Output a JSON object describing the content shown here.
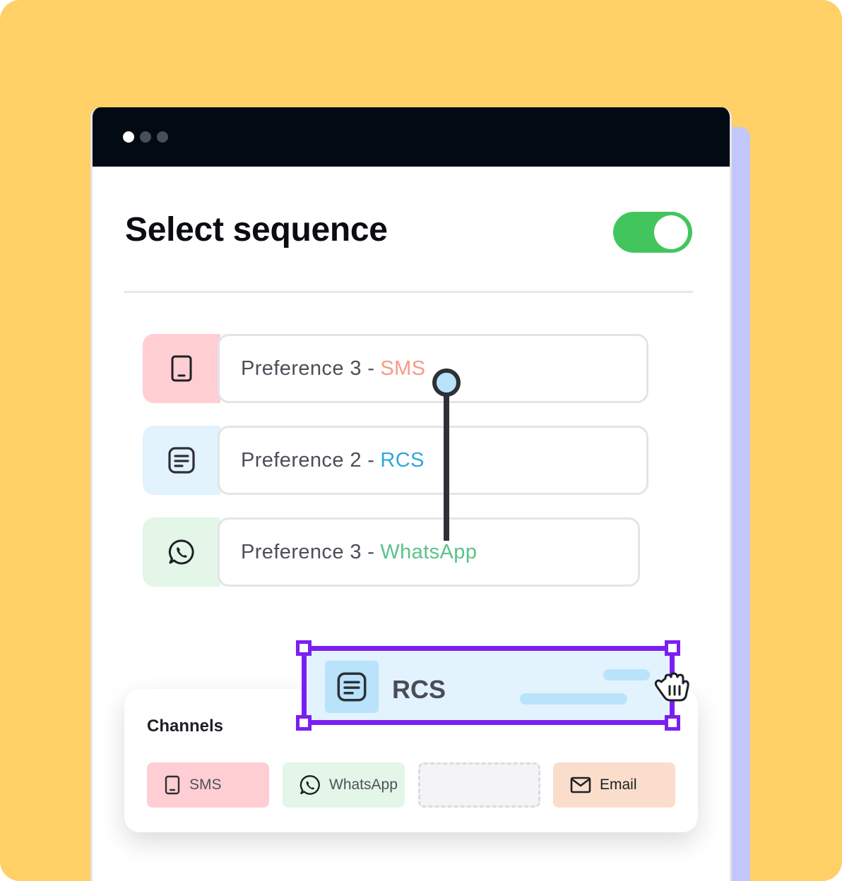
{
  "window": {
    "dots": [
      "close",
      "minimize",
      "maximize"
    ]
  },
  "header": {
    "title": "Select sequence",
    "toggle_on": true
  },
  "preferences": [
    {
      "label": "Preference 3 -",
      "channel": "SMS",
      "icon": "phone-icon",
      "color": "#F79A86"
    },
    {
      "label": "Preference 2 -",
      "channel": "RCS",
      "icon": "message-icon",
      "color": "#2FA7DE"
    },
    {
      "label": "Preference 3 -",
      "channel": "WhatsApp",
      "icon": "whatsapp-icon",
      "color": "#5BC287"
    }
  ],
  "dragging": {
    "label": "RCS",
    "icon": "message-icon",
    "selection_color": "#7B1FF0",
    "cursor": "grab-hand-icon"
  },
  "channels": {
    "title": "Channels",
    "items": [
      {
        "label": "SMS",
        "icon": "phone-icon"
      },
      {
        "label": "WhatsApp",
        "icon": "whatsapp-icon"
      },
      {
        "label": "",
        "icon": "",
        "placeholder": true
      },
      {
        "label": "Email",
        "icon": "mail-icon"
      }
    ]
  },
  "colors": {
    "background": "#FED066",
    "toggle": "#43C55E",
    "titlebar": "#020A14",
    "accent_panel": "#C2C6FA"
  }
}
